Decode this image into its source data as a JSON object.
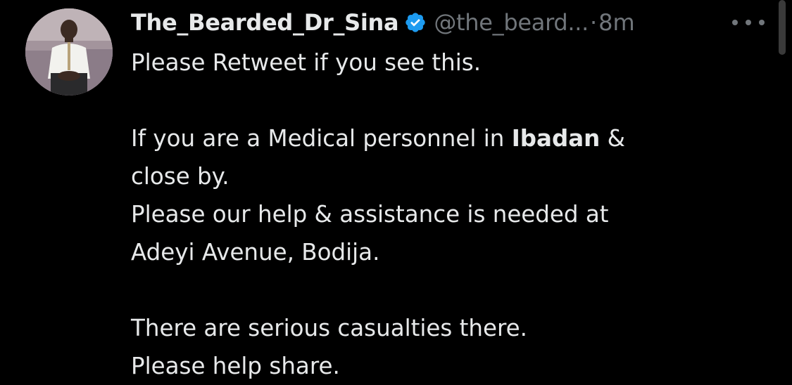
{
  "tweet": {
    "author": {
      "display_name": "The_Bearded_Dr_Sina",
      "verified": true,
      "handle": "@the_beard...",
      "avatar_icon": "profile-photo"
    },
    "separator": "·",
    "time_ago": "8m",
    "more_icon": "more-horizontal-icon",
    "text": {
      "line1": "Please Retweet if you see this.",
      "line2_before": "If you are a Medical personnel in ",
      "line2_bold": "Ibadan",
      "line2_after": " &",
      "line3": "close by.",
      "line4": "Please our help & assistance is needed at",
      "line5": "Adeyi Avenue, Bodija.",
      "line6": "There are serious casualties there.",
      "line7": "Please help share."
    }
  },
  "colors": {
    "background": "#000000",
    "text": "#e7e9ea",
    "secondary": "#71767b",
    "verified_blue": "#1d9bf0"
  }
}
